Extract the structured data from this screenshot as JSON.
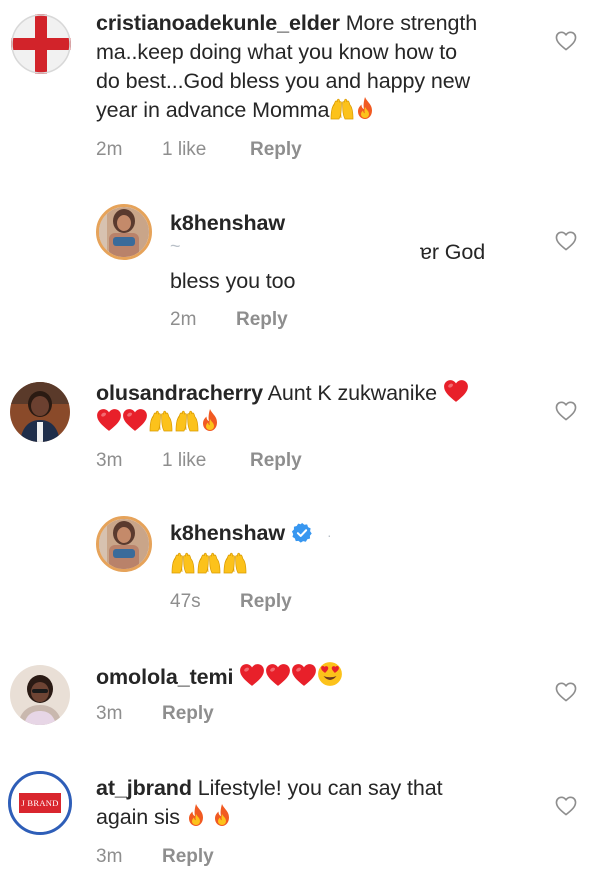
{
  "comments": [
    {
      "username": "cristianoadekunle_elder",
      "text_l1": "More strength",
      "text_l2": "ma..keep doing what you know how to",
      "text_l3": "do best...God bless you and happy new",
      "text_l4": "year in advance Momma",
      "time": "2m",
      "likes": "1 like",
      "reply": "Reply",
      "avatar": "england-flag-avatar"
    },
    {
      "username": "k8henshaw",
      "text_l1": "ɐr God",
      "text_l2": "bless you too",
      "time": "2m",
      "reply": "Reply",
      "avatar": "profile-photo-avatar"
    },
    {
      "username": "olusandracherry",
      "text_l1": "Aunt K zukwanike",
      "time": "3m",
      "likes": "1 like",
      "reply": "Reply",
      "avatar": "woman-photo-avatar"
    },
    {
      "username": "k8henshaw",
      "time": "47s",
      "reply": "Reply",
      "verified": true,
      "avatar": "profile-photo-avatar"
    },
    {
      "username": "omolola_temi",
      "time": "3m",
      "reply": "Reply",
      "avatar": "woman-photo-avatar"
    },
    {
      "username": "at_jbrand",
      "text_l1": "Lifestyle! you can say that",
      "text_l2": "again sis",
      "time": "3m",
      "reply": "Reply",
      "avatar": "jbrand-logo-avatar",
      "logo_text": "J BRAND"
    }
  ],
  "colors": {
    "text": "#262626",
    "meta": "#8e8e8e",
    "heart_emoji": "#e8202a",
    "verified_badge": "#3897f0"
  },
  "icons": [
    "heart-outline-icon",
    "fire-emoji",
    "raising-hands-emoji",
    "red-heart-emoji",
    "heart-eyes-emoji",
    "verified-badge-icon"
  ]
}
